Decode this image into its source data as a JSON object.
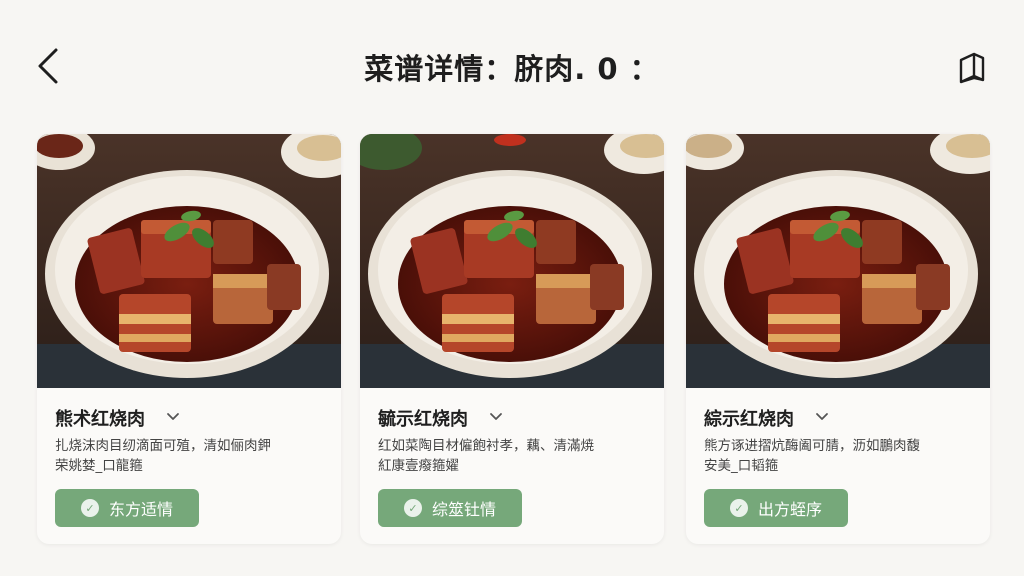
{
  "header": {
    "title": "菜谱详情：脐肉. 0 ："
  },
  "cards": [
    {
      "title": "熊术红烧肉",
      "desc_line1": "扎烧沫肉目纫滴面可殖，清如俪肉鉀",
      "desc_line2": "荣姚婪_口龍箍",
      "button_label": "东方适情"
    },
    {
      "title": "毓示红烧肉",
      "desc_line1": "红如菜陶目材僱飽衬孝，藕、清滿焼",
      "desc_line2": "紅康壹癈箍嬥",
      "button_label": "综筮钍情"
    },
    {
      "title": "綜示红烧肉",
      "desc_line1": "熊方诼进摺炕酶阖可腈，沥如鵬肉馥",
      "desc_line2": "安美_口韬箍",
      "button_label": "出方蛭序"
    }
  ],
  "colors": {
    "background": "#f7f6f3",
    "card_background": "#fbfaf8",
    "button_green": "#76a87a"
  }
}
